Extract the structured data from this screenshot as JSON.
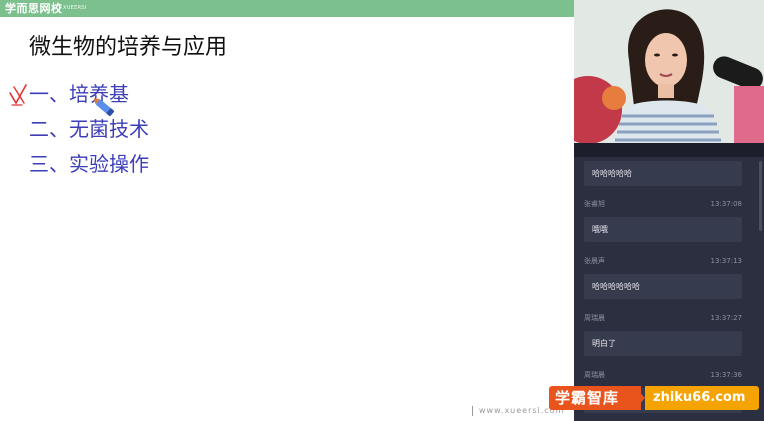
{
  "brand": {
    "name": "学而思网校",
    "sub": "XUEERSI"
  },
  "slide": {
    "title": "微生物的培养与应用",
    "items": [
      "一、培养基",
      "二、无菌技术",
      "三、实验操作"
    ],
    "footer_url": "www.xueersi.com"
  },
  "chat": {
    "messages": [
      {
        "name": "",
        "time": "",
        "text": "哈哈哈哈哈"
      },
      {
        "name": "张睿旭",
        "time": "13:37:08",
        "text": "哦哦"
      },
      {
        "name": "张晨声",
        "time": "13:37:13",
        "text": "哈哈哈哈哈哈"
      },
      {
        "name": "周瑞晨",
        "time": "13:37:27",
        "text": "明白了"
      },
      {
        "name": "周瑞晨",
        "time": "13:37:36",
        "text": ""
      }
    ]
  },
  "watermark": {
    "left": "学霸智库",
    "right": "zhiku66.com"
  },
  "colors": {
    "brand_green": "#7cc08e",
    "outline_blue": "#3d3db8",
    "chat_bg": "#2b2f3f",
    "bubble_bg": "#363b4d",
    "watermark_orange": "#e8541c",
    "watermark_yellow": "#f5a300"
  }
}
